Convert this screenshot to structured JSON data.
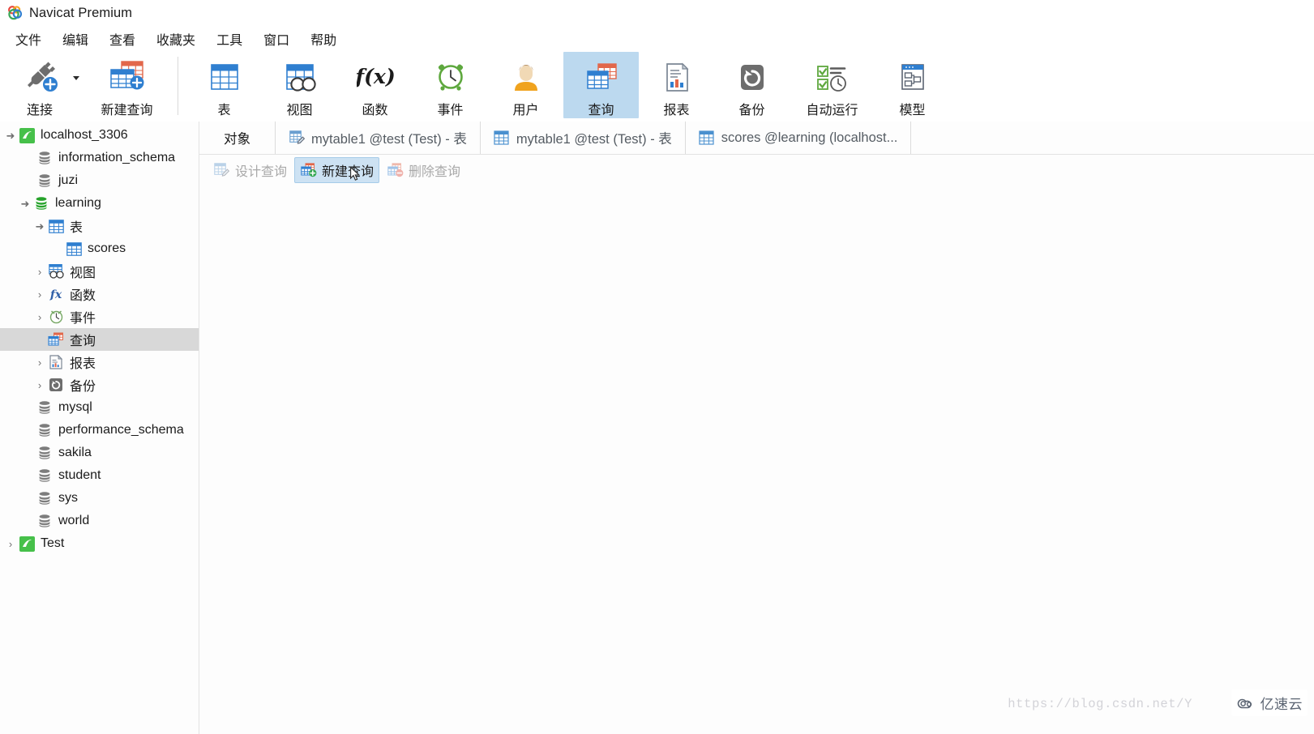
{
  "window": {
    "title": "Navicat Premium",
    "logo_icon": "navicat-logo-icon"
  },
  "menubar": {
    "items": [
      {
        "label": "文件",
        "name": "menu-file"
      },
      {
        "label": "编辑",
        "name": "menu-edit"
      },
      {
        "label": "查看",
        "name": "menu-view"
      },
      {
        "label": "收藏夹",
        "name": "menu-favorites"
      },
      {
        "label": "工具",
        "name": "menu-tools"
      },
      {
        "label": "窗口",
        "name": "menu-window"
      },
      {
        "label": "帮助",
        "name": "menu-help"
      }
    ]
  },
  "toolbar": {
    "buttons": [
      {
        "label": "连接",
        "icon": "connection-plug-icon",
        "active": false
      },
      {
        "label": "新建查询",
        "icon": "new-query-icon",
        "active": false
      },
      {
        "label": "表",
        "icon": "table-icon",
        "active": false
      },
      {
        "label": "视图",
        "icon": "view-icon",
        "active": false
      },
      {
        "label": "函数",
        "icon": "function-fx-icon",
        "active": false
      },
      {
        "label": "事件",
        "icon": "event-clock-icon",
        "active": false
      },
      {
        "label": "用户",
        "icon": "user-icon",
        "active": false
      },
      {
        "label": "查询",
        "icon": "query-icon",
        "active": true
      },
      {
        "label": "报表",
        "icon": "report-icon",
        "active": false
      },
      {
        "label": "备份",
        "icon": "backup-icon",
        "active": false
      },
      {
        "label": "自动运行",
        "icon": "automation-icon",
        "active": false
      },
      {
        "label": "模型",
        "icon": "model-icon",
        "active": false
      }
    ],
    "active_highlight_color": "#bcd9ef"
  },
  "tabs": [
    {
      "label": "对象",
      "icon": "",
      "name": "tab-objects"
    },
    {
      "label": "mytable1 @test (Test) - 表",
      "icon": "table-design-icon",
      "name": "tab-mytable1-design"
    },
    {
      "label": "mytable1 @test (Test) - 表",
      "icon": "table-data-icon",
      "name": "tab-mytable1-data"
    },
    {
      "label": "scores @learning (localhost...",
      "icon": "table-data-icon",
      "name": "tab-scores-learning"
    }
  ],
  "actionbar": {
    "buttons": [
      {
        "label": "设计查询",
        "icon": "design-query-icon",
        "state": "disabled",
        "name": "design-query-button"
      },
      {
        "label": "新建查询",
        "icon": "new-query-plus-icon",
        "state": "hovered",
        "name": "new-query-button"
      },
      {
        "label": "删除查询",
        "icon": "delete-query-icon",
        "state": "disabled",
        "name": "delete-query-button"
      }
    ],
    "hover_color": "#cde2f3"
  },
  "sidebar": {
    "tree": [
      {
        "label": "localhost_3306",
        "icon": "connection-icon",
        "indent": 0,
        "twisty": "expanded",
        "selected": false,
        "name": "tree-item-localhost-3306"
      },
      {
        "label": "information_schema",
        "icon": "database-gray-icon",
        "indent": 1,
        "twisty": "none",
        "selected": false,
        "name": "tree-item-information-schema"
      },
      {
        "label": "juzi",
        "icon": "database-gray-icon",
        "indent": 1,
        "twisty": "none",
        "selected": false,
        "name": "tree-item-juzi"
      },
      {
        "label": "learning",
        "icon": "database-green-icon",
        "indent": 1,
        "twisty": "expanded",
        "selected": false,
        "name": "tree-item-learning"
      },
      {
        "label": "表",
        "icon": "table-icon",
        "indent": 2,
        "twisty": "expanded",
        "selected": false,
        "name": "tree-item-tables"
      },
      {
        "label": "scores",
        "icon": "table-icon",
        "indent": 3,
        "twisty": "none",
        "selected": false,
        "name": "tree-item-scores"
      },
      {
        "label": "视图",
        "icon": "view-icon",
        "indent": 2,
        "twisty": "collapsed",
        "selected": false,
        "name": "tree-item-views"
      },
      {
        "label": "函数",
        "icon": "function-fx-icon",
        "indent": 2,
        "twisty": "collapsed",
        "selected": false,
        "name": "tree-item-functions"
      },
      {
        "label": "事件",
        "icon": "event-clock-icon",
        "indent": 2,
        "twisty": "collapsed",
        "selected": false,
        "name": "tree-item-events"
      },
      {
        "label": "查询",
        "icon": "query-icon",
        "indent": 2,
        "twisty": "none",
        "selected": true,
        "name": "tree-item-queries"
      },
      {
        "label": "报表",
        "icon": "report-icon",
        "indent": 2,
        "twisty": "collapsed",
        "selected": false,
        "name": "tree-item-reports"
      },
      {
        "label": "备份",
        "icon": "backup-icon",
        "indent": 2,
        "twisty": "collapsed",
        "selected": false,
        "name": "tree-item-backups"
      },
      {
        "label": "mysql",
        "icon": "database-gray-icon",
        "indent": 1,
        "twisty": "none",
        "selected": false,
        "name": "tree-item-mysql"
      },
      {
        "label": "performance_schema",
        "icon": "database-gray-icon",
        "indent": 1,
        "twisty": "none",
        "selected": false,
        "name": "tree-item-performance-schema"
      },
      {
        "label": "sakila",
        "icon": "database-gray-icon",
        "indent": 1,
        "twisty": "none",
        "selected": false,
        "name": "tree-item-sakila"
      },
      {
        "label": "student",
        "icon": "database-gray-icon",
        "indent": 1,
        "twisty": "none",
        "selected": false,
        "name": "tree-item-student"
      },
      {
        "label": "sys",
        "icon": "database-gray-icon",
        "indent": 1,
        "twisty": "none",
        "selected": false,
        "name": "tree-item-sys"
      },
      {
        "label": "world",
        "icon": "database-gray-icon",
        "indent": 1,
        "twisty": "none",
        "selected": false,
        "name": "tree-item-world"
      },
      {
        "label": "Test",
        "icon": "connection-icon",
        "indent": 0,
        "twisty": "collapsed",
        "selected": false,
        "name": "tree-item-test"
      }
    ],
    "selected_color": "#d8d8d8"
  },
  "watermarks": {
    "url": "https://blog.csdn.net/Y",
    "badge_text": "亿速云",
    "badge_icon": "cloud-icon"
  }
}
